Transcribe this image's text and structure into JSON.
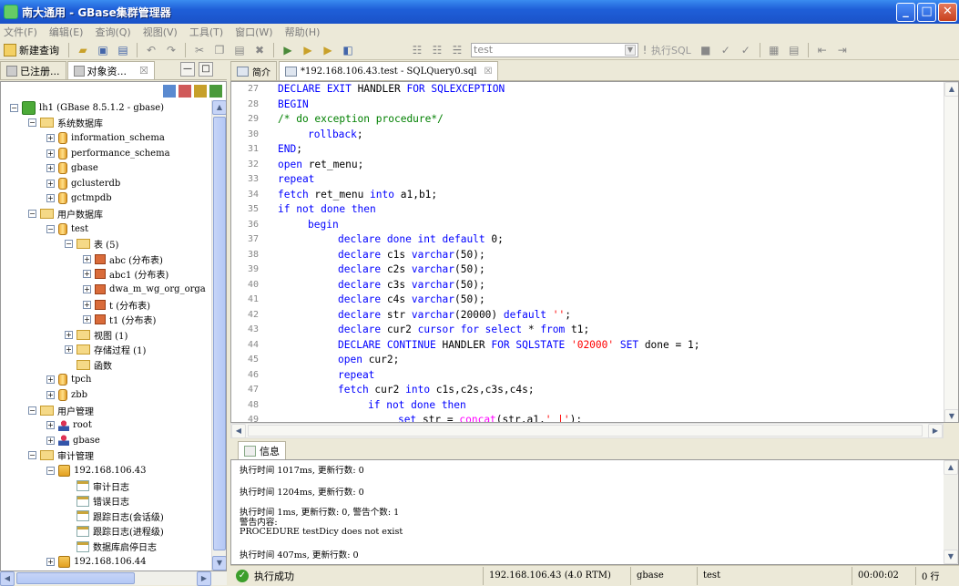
{
  "window": {
    "title": "南大通用 - GBase集群管理器"
  },
  "menu": [
    "文件(F)",
    "编辑(E)",
    "查询(Q)",
    "视图(V)",
    "工具(T)",
    "窗口(W)",
    "帮助(H)"
  ],
  "toolbar": {
    "new_query": "新建查询",
    "database": "test",
    "execute": "执行SQL"
  },
  "left_tabs": [
    "已注册...",
    "对象资...",
    "☒"
  ],
  "tree": [
    {
      "indent": 0,
      "exp": "⊟",
      "icon": "root",
      "label": "lh1 (GBase 8.5.1.2 - gbase)"
    },
    {
      "indent": 1,
      "exp": "⊟",
      "icon": "folder",
      "label": "系统数据库"
    },
    {
      "indent": 2,
      "exp": "⊞",
      "icon": "db",
      "label": "information_schema"
    },
    {
      "indent": 2,
      "exp": "⊞",
      "icon": "db",
      "label": "performance_schema"
    },
    {
      "indent": 2,
      "exp": "⊞",
      "icon": "db",
      "label": "gbase"
    },
    {
      "indent": 2,
      "exp": "⊞",
      "icon": "db",
      "label": "gclusterdb"
    },
    {
      "indent": 2,
      "exp": "⊞",
      "icon": "db",
      "label": "gctmpdb"
    },
    {
      "indent": 1,
      "exp": "⊟",
      "icon": "folder",
      "label": "用户数据库"
    },
    {
      "indent": 2,
      "exp": "⊟",
      "icon": "db",
      "label": "test"
    },
    {
      "indent": 3,
      "exp": "⊟",
      "icon": "folder",
      "label": "表 (5)"
    },
    {
      "indent": 4,
      "exp": "⊞",
      "icon": "table",
      "label": "abc (分布表)"
    },
    {
      "indent": 4,
      "exp": "⊞",
      "icon": "table",
      "label": "abc1 (分布表)"
    },
    {
      "indent": 4,
      "exp": "⊞",
      "icon": "table",
      "label": "dwa_m_wg_org_orga"
    },
    {
      "indent": 4,
      "exp": "⊞",
      "icon": "table",
      "label": "t (分布表)"
    },
    {
      "indent": 4,
      "exp": "⊞",
      "icon": "table",
      "label": "t1 (分布表)"
    },
    {
      "indent": 3,
      "exp": "⊞",
      "icon": "folder",
      "label": "视图 (1)"
    },
    {
      "indent": 3,
      "exp": "⊞",
      "icon": "folder",
      "label": "存储过程 (1)"
    },
    {
      "indent": 3,
      "exp": "",
      "icon": "folder",
      "label": "函数"
    },
    {
      "indent": 2,
      "exp": "⊞",
      "icon": "db",
      "label": "tpch"
    },
    {
      "indent": 2,
      "exp": "⊞",
      "icon": "db",
      "label": "zbb"
    },
    {
      "indent": 1,
      "exp": "⊟",
      "icon": "folder",
      "label": "用户管理"
    },
    {
      "indent": 2,
      "exp": "⊞",
      "icon": "user",
      "label": "root"
    },
    {
      "indent": 2,
      "exp": "⊞",
      "icon": "user",
      "label": "gbase"
    },
    {
      "indent": 1,
      "exp": "⊟",
      "icon": "folder",
      "label": "审计管理"
    },
    {
      "indent": 2,
      "exp": "⊟",
      "icon": "server",
      "label": "192.168.106.43"
    },
    {
      "indent": 3,
      "exp": "",
      "icon": "log",
      "label": "审计日志"
    },
    {
      "indent": 3,
      "exp": "",
      "icon": "log",
      "label": "错误日志"
    },
    {
      "indent": 3,
      "exp": "",
      "icon": "log",
      "label": "跟踪日志(会话级)"
    },
    {
      "indent": 3,
      "exp": "",
      "icon": "log",
      "label": "跟踪日志(进程级)"
    },
    {
      "indent": 3,
      "exp": "",
      "icon": "log",
      "label": "数据库启停日志"
    },
    {
      "indent": 2,
      "exp": "⊞",
      "icon": "server",
      "label": "192.168.106.44"
    }
  ],
  "editor_tabs": [
    {
      "label": "简介"
    },
    {
      "label": "*192.168.106.43.test - SQLQuery0.sql",
      "close": "☒"
    }
  ],
  "code": [
    {
      "n": "27",
      "i": 0,
      "t": [
        [
          "kw",
          "DECLARE EXIT "
        ],
        [
          "",
          "HANDLER "
        ],
        [
          "kw",
          "FOR SQLEXCEPTION"
        ]
      ]
    },
    {
      "n": "28",
      "i": 0,
      "t": [
        [
          "kw",
          "BEGIN"
        ]
      ]
    },
    {
      "n": "29",
      "i": 0,
      "t": [
        [
          "cm",
          "/* do exception procedure*/"
        ]
      ]
    },
    {
      "n": "30",
      "i": 1,
      "t": [
        [
          "kw",
          "rollback"
        ],
        [
          "",
          ";"
        ]
      ]
    },
    {
      "n": "31",
      "i": 0,
      "t": [
        [
          "kw",
          "END"
        ],
        [
          "",
          ";"
        ]
      ]
    },
    {
      "n": "32",
      "i": 0,
      "t": [
        [
          "kw",
          "open "
        ],
        [
          "",
          "ret_menu;"
        ]
      ]
    },
    {
      "n": "33",
      "i": 0,
      "t": [
        [
          "kw",
          "repeat"
        ]
      ]
    },
    {
      "n": "34",
      "i": 0,
      "t": [
        [
          "kw",
          "fetch "
        ],
        [
          "",
          "ret_menu "
        ],
        [
          "kw",
          "into "
        ],
        [
          "",
          "a1,b1;"
        ]
      ]
    },
    {
      "n": "35",
      "i": 0,
      "t": [
        [
          "kw",
          "if not done then"
        ]
      ]
    },
    {
      "n": "36",
      "i": 1,
      "t": [
        [
          "kw",
          "begin"
        ]
      ]
    },
    {
      "n": "37",
      "i": 2,
      "t": [
        [
          "kw",
          "declare done int default "
        ],
        [
          "",
          "0;"
        ]
      ]
    },
    {
      "n": "38",
      "i": 2,
      "t": [
        [
          "kw",
          "declare "
        ],
        [
          "",
          "c1s "
        ],
        [
          "kw",
          "varchar"
        ],
        [
          "",
          "(50);"
        ]
      ]
    },
    {
      "n": "39",
      "i": 2,
      "t": [
        [
          "kw",
          "declare "
        ],
        [
          "",
          "c2s "
        ],
        [
          "kw",
          "varchar"
        ],
        [
          "",
          "(50);"
        ]
      ]
    },
    {
      "n": "40",
      "i": 2,
      "t": [
        [
          "kw",
          "declare "
        ],
        [
          "",
          "c3s "
        ],
        [
          "kw",
          "varchar"
        ],
        [
          "",
          "(50);"
        ]
      ]
    },
    {
      "n": "41",
      "i": 2,
      "t": [
        [
          "kw",
          "declare "
        ],
        [
          "",
          "c4s "
        ],
        [
          "kw",
          "varchar"
        ],
        [
          "",
          "(50);"
        ]
      ]
    },
    {
      "n": "42",
      "i": 2,
      "t": [
        [
          "kw",
          "declare "
        ],
        [
          "",
          "str "
        ],
        [
          "kw",
          "varchar"
        ],
        [
          "",
          "(20000) "
        ],
        [
          "kw",
          "default "
        ],
        [
          "st",
          "''"
        ],
        [
          "",
          ";"
        ]
      ]
    },
    {
      "n": "43",
      "i": 2,
      "t": [
        [
          "kw",
          "declare "
        ],
        [
          "",
          "cur2 "
        ],
        [
          "kw",
          "cursor for select "
        ],
        [
          "",
          "* "
        ],
        [
          "kw",
          "from "
        ],
        [
          "",
          "t1;"
        ]
      ]
    },
    {
      "n": "44",
      "i": 2,
      "t": [
        [
          "kw",
          "DECLARE CONTINUE "
        ],
        [
          "",
          "HANDLER "
        ],
        [
          "kw",
          "FOR SQLSTATE "
        ],
        [
          "st",
          "'02000' "
        ],
        [
          "kw",
          "SET "
        ],
        [
          "",
          "done = 1;"
        ]
      ]
    },
    {
      "n": "45",
      "i": 2,
      "t": [
        [
          "kw",
          "open "
        ],
        [
          "",
          "cur2;"
        ]
      ]
    },
    {
      "n": "46",
      "i": 2,
      "t": [
        [
          "kw",
          "repeat"
        ]
      ]
    },
    {
      "n": "47",
      "i": 2,
      "t": [
        [
          "kw",
          "fetch "
        ],
        [
          "",
          "cur2 "
        ],
        [
          "kw",
          "into "
        ],
        [
          "",
          "c1s,c2s,c3s,c4s;"
        ]
      ]
    },
    {
      "n": "48",
      "i": 3,
      "t": [
        [
          "kw",
          "if not done then"
        ]
      ]
    },
    {
      "n": "49",
      "i": 4,
      "t": [
        [
          "kw",
          "set "
        ],
        [
          "",
          "str = "
        ],
        [
          "fn",
          "concat"
        ],
        [
          "",
          "(str,a1,"
        ],
        [
          "st",
          "' |'"
        ],
        [
          "",
          ");"
        ]
      ]
    }
  ],
  "info_tab": "信息",
  "messages": [
    "执行时间 1017ms, 更新行数: 0",
    "执行时间 1204ms, 更新行数: 0",
    "执行时间 1ms, 更新行数: 0, 警告个数: 1",
    "警告内容:",
    "PROCEDURE testDicy does not exist",
    "执行时间 407ms, 更新行数: 0"
  ],
  "status": {
    "result": "执行成功",
    "server": "192.168.106.43 (4.0 RTM)",
    "user": "gbase",
    "db": "test",
    "time": "00:00:02",
    "rows": "0 行"
  }
}
